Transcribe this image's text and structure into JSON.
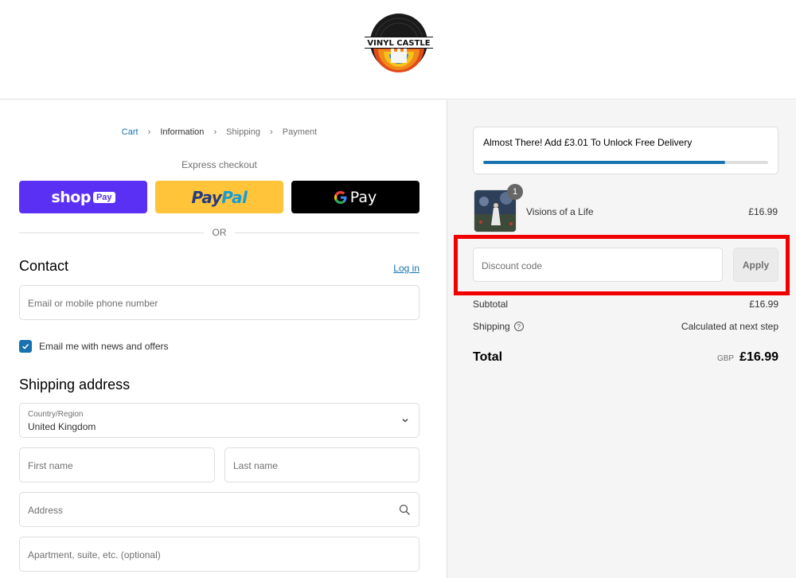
{
  "brand": {
    "logo_text": "VINYL CASTLE"
  },
  "breadcrumb": {
    "cart": "Cart",
    "information": "Information",
    "shipping": "Shipping",
    "payment": "Payment"
  },
  "express": {
    "title": "Express checkout",
    "shop_pay_word": "shop",
    "shop_pay_badge": "Pay",
    "paypal_part1": "Pay",
    "paypal_part2": "Pal",
    "gpay_word": "Pay",
    "or_text": "OR"
  },
  "contact": {
    "title": "Contact",
    "login_label": "Log in",
    "email_placeholder": "Email or mobile phone number",
    "newsletter_label": "Email me with news and offers",
    "newsletter_checked": true
  },
  "shipping_address": {
    "title": "Shipping address",
    "country_label": "Country/Region",
    "country_value": "United Kingdom",
    "first_name_placeholder": "First name",
    "last_name_placeholder": "Last name",
    "address_placeholder": "Address",
    "apartment_placeholder": "Apartment, suite, etc. (optional)"
  },
  "summary": {
    "promo_text": "Almost There! Add £3.01 To Unlock Free Delivery",
    "promo_progress": 0.85,
    "item": {
      "quantity": "1",
      "name": "Visions of a Life",
      "price": "£16.99"
    },
    "discount_placeholder": "Discount code",
    "apply_label": "Apply",
    "subtotal_label": "Subtotal",
    "subtotal_value": "£16.99",
    "shipping_label": "Shipping",
    "shipping_value": "Calculated at next step",
    "total_label": "Total",
    "currency": "GBP",
    "total_value": "£16.99"
  },
  "colors": {
    "accent": "#1773b0",
    "shop_pay": "#5a31f4",
    "paypal": "#ffc439",
    "highlight": "#f10000"
  }
}
